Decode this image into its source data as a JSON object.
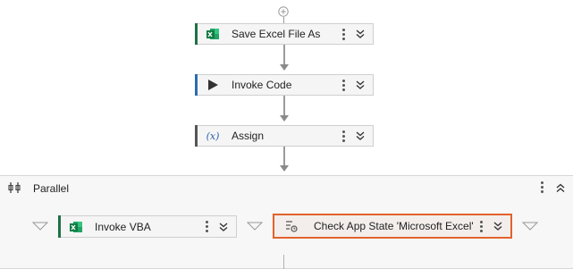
{
  "workflow": {
    "activities": [
      {
        "label": "Save Excel File As",
        "icon": "excel-icon",
        "accent": "#1e7145"
      },
      {
        "label": "Invoke Code",
        "icon": "play-icon",
        "accent": "#2b6cb0"
      },
      {
        "label": "Assign",
        "icon": "assign-x-icon",
        "accent": "#555555"
      }
    ],
    "parallel": {
      "label": "Parallel",
      "branches": [
        {
          "label": "Invoke VBA",
          "icon": "excel-icon",
          "accent": "#1e7145"
        },
        {
          "label": "Check App State 'Microsoft Excel'",
          "icon": "app-state-icon",
          "selected": true,
          "selection_color": "#e2622b"
        }
      ]
    },
    "assign_icon_text": "(x)"
  }
}
